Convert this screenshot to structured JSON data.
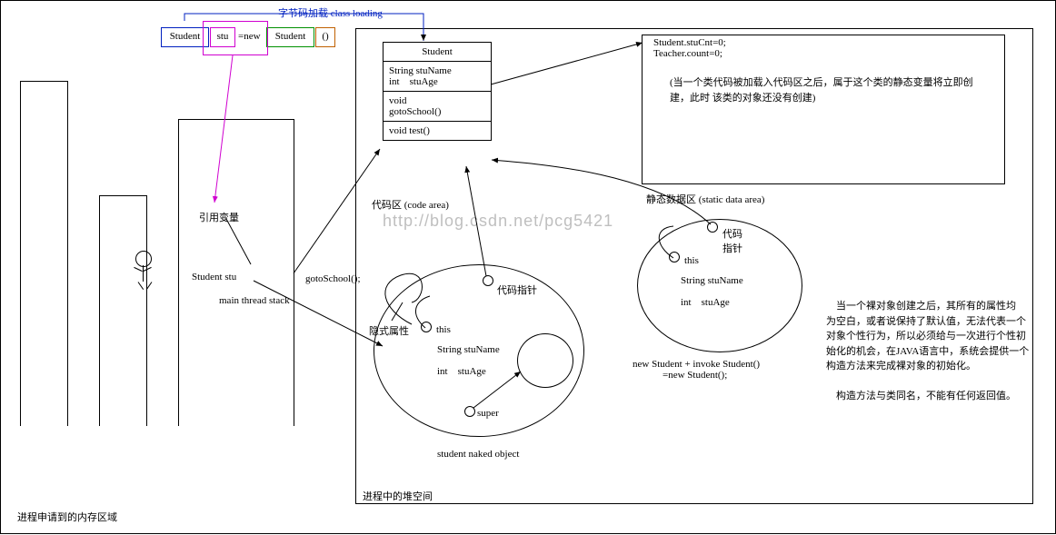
{
  "title_bar": {
    "class_loading_label": "字节码加载 class loading",
    "tokens": {
      "student_type": "Student",
      "var_name": "stu",
      "equals_new": "=new",
      "student_ctor": "Student",
      "parens": "()"
    }
  },
  "watermark": "http://blog.csdn.net/pcg5421",
  "stack": {
    "ref_var_label": "引用变量",
    "student_stu": "Student stu",
    "main_thread_stack": "main thread stack",
    "gotoSchool_call": "gotoSchool();"
  },
  "code_area": {
    "label": "代码区 (code area)",
    "class_name": "Student",
    "fields": "String stuName\nint    stuAge",
    "method1": "void\ngotoSchool()",
    "method2": "void test()"
  },
  "static_area": {
    "label": "静态数据区 (static data area)",
    "vars": "Student.stuCnt=0;\nTeacher.count=0;",
    "comment": "(当一个类代码被加载入代码区之后，属于这个类的静态变量将立即创建，此时 该类的对象还没有创建)"
  },
  "heap": {
    "label": "进程中的堆空间",
    "implicit_attr": "隐式属性",
    "obj1": {
      "code_ptr": "代码指针",
      "this": "this",
      "fields": "String stuName\n\nint    stuAge",
      "super": "super",
      "caption": "student naked object"
    },
    "obj2": {
      "code_ptr": "代码\n指针",
      "this": "this",
      "fields": "String stuName\n\nint    stuAge",
      "caption": "new Student + invoke Student()\n            =new Student();"
    }
  },
  "notes": {
    "paragraph": "    当一个裸对象创建之后，其所有的属性均\n为空白，或者说保持了默认值，无法代表一个\n对象个性行为，所以必须给与一次进行个性初\n始化的机会，在JAVA语言中，系统会提供一个\n构造方法来完成裸对象的初始化。\n\n    构造方法与类同名，不能有任何返回值。"
  },
  "footer": "进程申请到的内存区域"
}
